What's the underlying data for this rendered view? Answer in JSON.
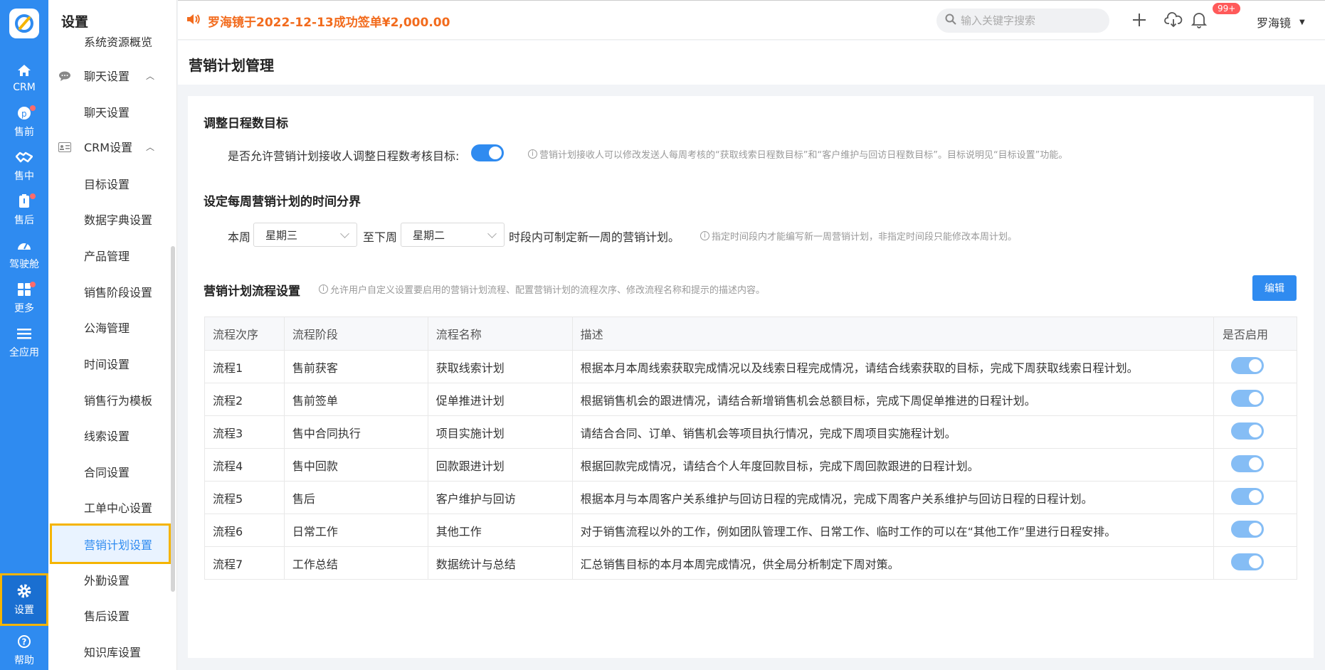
{
  "rail": {
    "items": [
      {
        "label": "CRM",
        "icon": "home-icon"
      },
      {
        "label": "售前",
        "icon": "pin-icon",
        "dot": true
      },
      {
        "label": "售中",
        "icon": "handshake-icon"
      },
      {
        "label": "售后",
        "icon": "clipboard-icon",
        "dot": true
      },
      {
        "label": "驾驶舱",
        "icon": "dashboard-icon"
      },
      {
        "label": "更多",
        "icon": "grid-icon",
        "dot": true
      },
      {
        "label": "全应用",
        "icon": "menu-icon"
      },
      {
        "label": "设置",
        "icon": "gear-icon"
      },
      {
        "label": "帮助",
        "icon": "help-icon"
      }
    ]
  },
  "sidebar": {
    "title": "设置",
    "partial_item": "系统资源概览",
    "group_chat": "聊天设置",
    "chat_item": "聊天设置",
    "group_crm": "CRM设置",
    "items": [
      "目标设置",
      "数据字典设置",
      "产品管理",
      "销售阶段设置",
      "公海管理",
      "时间设置",
      "销售行为模板",
      "线索设置",
      "合同设置",
      "工单中心设置",
      "营销计划设置",
      "外勤设置",
      "售后设置",
      "知识库设置"
    ]
  },
  "topbar": {
    "announcement": "罗海镜于2022-12-13成功签单¥2,000.00",
    "search_placeholder": "输入关键字搜索",
    "badge": "99+",
    "user": "罗海镜"
  },
  "page": {
    "title": "营销计划管理"
  },
  "section1": {
    "title": "调整日程数目标",
    "label": "是否允许营销计划接收人调整日程数考核目标:",
    "hint": "营销计划接收人可以修改发送人每周考核的“获取线索日程数目标”和“客户维护与回访日程数目标”。目标说明见“目标设置”功能。"
  },
  "section2": {
    "title": "设定每周营销计划的时间分界",
    "this_week": "本周",
    "this_week_value": "星期三",
    "to_next_week": "至下周",
    "next_week_value": "星期二",
    "suffix": "时段内可制定新一周的营销计划。",
    "hint": "指定时间段内才能编写新一周营销计划，非指定时间段只能修改本周计划。"
  },
  "section3": {
    "title": "营销计划流程设置",
    "hint": "允许用户自定义设置要启用的营销计划流程、配置营销计划的流程次序、修改流程名称和提示的描述内容。",
    "edit_label": "编辑",
    "columns": [
      "流程次序",
      "流程阶段",
      "流程名称",
      "描述",
      "是否启用"
    ],
    "rows": [
      {
        "order": "流程1",
        "stage": "售前获客",
        "name": "获取线索计划",
        "desc": "根据本月本周线索获取完成情况以及线索日程完成情况，请结合线索获取的目标，完成下周获取线索日程计划。",
        "enabled": true
      },
      {
        "order": "流程2",
        "stage": "售前签单",
        "name": "促单推进计划",
        "desc": "根据销售机会的跟进情况，请结合新增销售机会总额目标，完成下周促单推进的日程计划。",
        "enabled": true
      },
      {
        "order": "流程3",
        "stage": "售中合同执行",
        "name": "项目实施计划",
        "desc": "请结合合同、订单、销售机会等项目执行情况，完成下周项目实施程计划。",
        "enabled": true
      },
      {
        "order": "流程4",
        "stage": "售中回款",
        "name": "回款跟进计划",
        "desc": "根据回款完成情况，请结合个人年度回款目标，完成下周回款跟进的日程计划。",
        "enabled": true
      },
      {
        "order": "流程5",
        "stage": "售后",
        "name": "客户维护与回访",
        "desc": "根据本月与本周客户关系维护与回访日程的完成情况，完成下周客户关系维护与回访日程的日程计划。",
        "enabled": true
      },
      {
        "order": "流程6",
        "stage": "日常工作",
        "name": "其他工作",
        "desc": "对于销售流程以外的工作，例如团队管理工作、日常工作、临时工作的可以在“其他工作”里进行日程安排。",
        "enabled": true
      },
      {
        "order": "流程7",
        "stage": "工作总结",
        "name": "数据统计与总结",
        "desc": "汇总销售目标的本月本周完成情况，供全局分析制定下周对策。",
        "enabled": true
      }
    ]
  },
  "colors": {
    "primary": "#2f8bf0",
    "announce": "#f26b1d",
    "highlight": "#f5b400",
    "badge": "#ff5a5a"
  }
}
